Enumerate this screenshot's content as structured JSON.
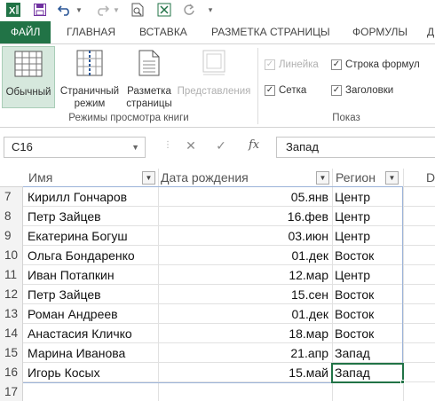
{
  "ribbon_tabs": [
    "ФАЙЛ",
    "ГЛАВНАЯ",
    "ВСТАВКА",
    "РАЗМЕТКА СТРАНИЦЫ",
    "ФОРМУЛЫ",
    "Д"
  ],
  "ribbon": {
    "views": {
      "normal": "Обычный",
      "page_line1": "Страничный",
      "page_line2": "режим",
      "layout_line1": "Разметка",
      "layout_line2": "страницы",
      "custom": "Представления",
      "group_label": "Режимы просмотра книги"
    },
    "show": {
      "ruler": "Линейка",
      "formula_bar": "Строка формул",
      "gridlines": "Сетка",
      "headings": "Заголовки",
      "group_label": "Показ"
    }
  },
  "formula_bar": {
    "name_box": "C16",
    "cancel_icon": "✕",
    "enter_icon": "✓",
    "fx": "fx",
    "content": "Запад"
  },
  "sheet": {
    "headers": {
      "name": "Имя",
      "birth": "Дата рождения",
      "region": "Регион",
      "d": "D"
    },
    "rows": [
      {
        "num": "7",
        "name": "Кирилл Гончаров",
        "date": "05.янв",
        "region": "Центр"
      },
      {
        "num": "8",
        "name": "Петр Зайцев",
        "date": "16.фев",
        "region": "Центр"
      },
      {
        "num": "9",
        "name": "Екатерина Богуш",
        "date": "03.июн",
        "region": "Центр"
      },
      {
        "num": "10",
        "name": "Ольга Бондаренко",
        "date": "01.дек",
        "region": "Восток"
      },
      {
        "num": "11",
        "name": "Иван Потапкин",
        "date": "12.мар",
        "region": "Центр"
      },
      {
        "num": "12",
        "name": "Петр Зайцев",
        "date": "15.сен",
        "region": "Восток"
      },
      {
        "num": "13",
        "name": "Роман Андреев",
        "date": "01.дек",
        "region": "Восток"
      },
      {
        "num": "14",
        "name": "Анастасия Кличко",
        "date": "18.мар",
        "region": "Восток"
      },
      {
        "num": "15",
        "name": "Марина Иванова",
        "date": "21.апр",
        "region": "Запад"
      },
      {
        "num": "16",
        "name": "Игорь Косых",
        "date": "15.май",
        "region": "Запад"
      },
      {
        "num": "17",
        "name": "",
        "date": "",
        "region": ""
      }
    ]
  },
  "colors": {
    "accent": "#217346",
    "table_border": "#9bb3d9"
  }
}
